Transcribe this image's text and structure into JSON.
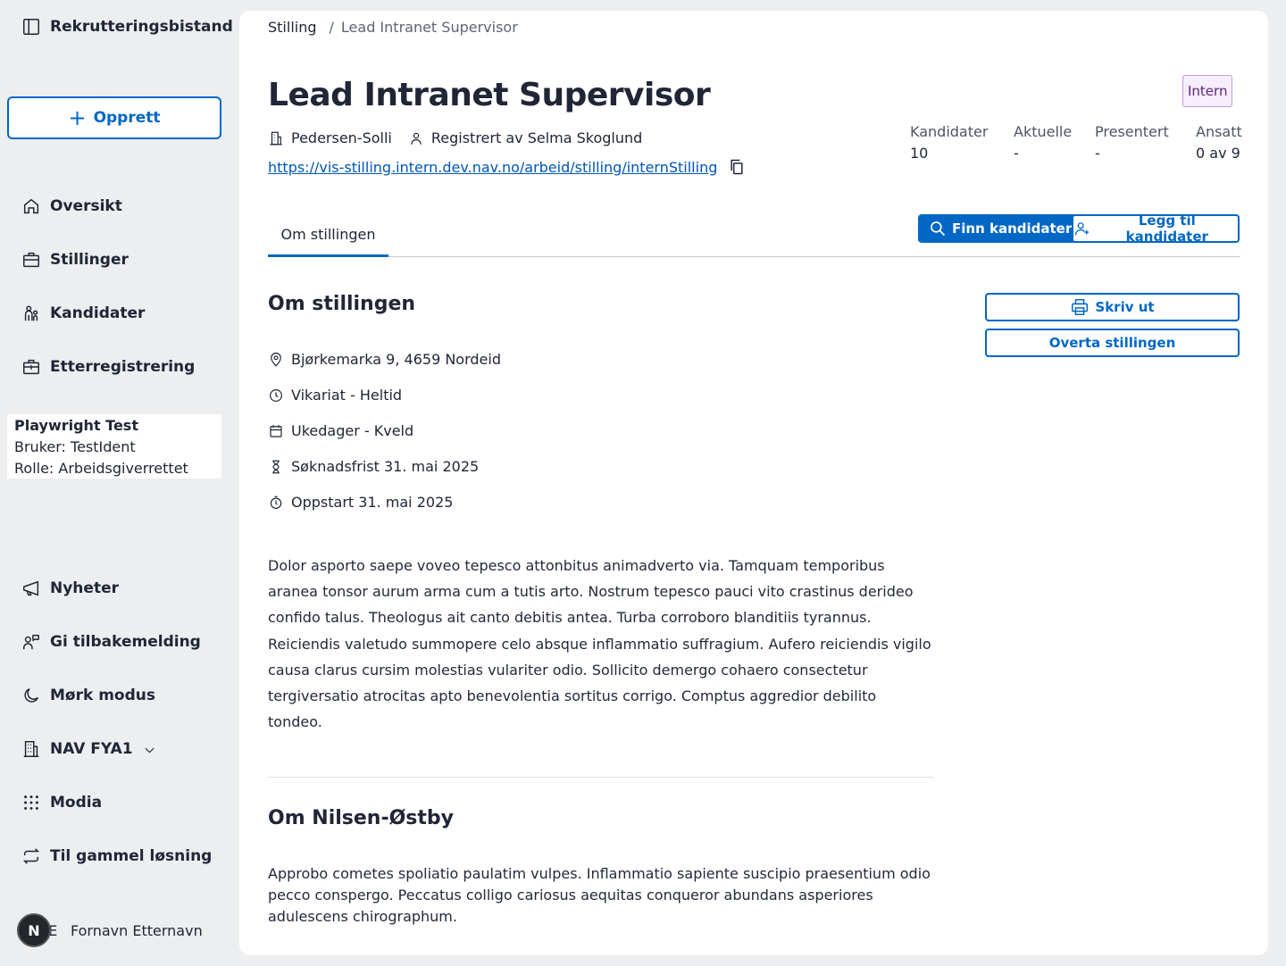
{
  "app": {
    "title": "Rekrutteringsbistand",
    "create_label": "Opprett"
  },
  "nav": {
    "primary": [
      {
        "label": "Oversikt",
        "icon": "house-icon"
      },
      {
        "label": "Stillinger",
        "icon": "briefcase-icon"
      },
      {
        "label": "Kandidater",
        "icon": "persons-icon"
      },
      {
        "label": "Etterregistrering",
        "icon": "briefcase-plus-icon"
      }
    ],
    "secondary": [
      {
        "label": "Nyheter",
        "icon": "megaphone-icon"
      },
      {
        "label": "Gi tilbakemelding",
        "icon": "feedback-icon"
      },
      {
        "label": "Mørk modus",
        "icon": "moon-icon"
      },
      {
        "label": "NAV FYA1",
        "icon": "buildings-icon"
      },
      {
        "label": "Modia",
        "icon": "grid-dots-icon"
      },
      {
        "label": "Til gammel løsning",
        "icon": "arrows-circle-icon"
      }
    ]
  },
  "user": {
    "name": "Playwright Test",
    "ident": "Bruker: TestIdent",
    "role": "Rolle: Arbeidsgiverrettet"
  },
  "profile": {
    "avatar_letter": "N",
    "initials": "FE",
    "name": "Fornavn Etternavn"
  },
  "breadcrumb": {
    "root": "Stilling",
    "separator": "/",
    "current": "Lead Intranet Supervisor"
  },
  "job": {
    "title": "Lead Intranet Supervisor",
    "tag": "Intern",
    "employer": "Pedersen-Solli",
    "registered_by": "Registrert av Selma Skoglund",
    "url": "https://vis-stilling.intern.dev.nav.no/arbeid/stilling/internStilling"
  },
  "stats": [
    {
      "label": "Kandidater",
      "value": "10"
    },
    {
      "label": "Aktuelle",
      "value": "-"
    },
    {
      "label": "Presentert",
      "value": "-"
    },
    {
      "label": "Ansatt",
      "value": "0 av 9"
    }
  ],
  "tabs": {
    "active": "Om stillingen"
  },
  "actions": {
    "find": "Finn kandidater",
    "add": "Legg til kandidater",
    "print": "Skriv ut",
    "takeover": "Overta stillingen"
  },
  "about": {
    "heading": "Om stillingen",
    "address": "Bjørkemarka 9, 4659 Nordeid",
    "employment": "Vikariat - Heltid",
    "workdays": "Ukedager - Kveld",
    "deadline": "Søknadsfrist 31. mai 2025",
    "start": "Oppstart 31. mai 2025",
    "description": "Dolor asporto saepe voveo tepesco attonbitus animadverto via. Tamquam temporibus aranea tonsor aurum arma cum a tutis arto. Nostrum tepesco pauci vito crastinus derideo confido talus. Theologus ait canto debitis antea. Turba corroboro blanditiis tyrannus. Reiciendis valetudo summopere celo absque inflammatio suffragium. Aufero reiciendis vigilo causa clarus cursim molestias vulariter odio. Sollicito demergo cohaero consectetur tergiversatio atrocitas apto benevolentia sortitus corrigo. Comptus aggredior debilito tondeo."
  },
  "employer_section": {
    "heading": "Om Nilsen-Østby",
    "text": "Approbo cometes spoliatio paulatim vulpes. Inflammatio sapiente suscipio praesentium odio pecco conspergo. Peccatus colligo cariosus aequitas conqueror abundans asperiores adulescens chirographum."
  },
  "colors": {
    "accent": "#0067c5",
    "tag_bg": "#f6eefb",
    "tag_text": "#60227b",
    "page_bg": "#eceef0"
  }
}
